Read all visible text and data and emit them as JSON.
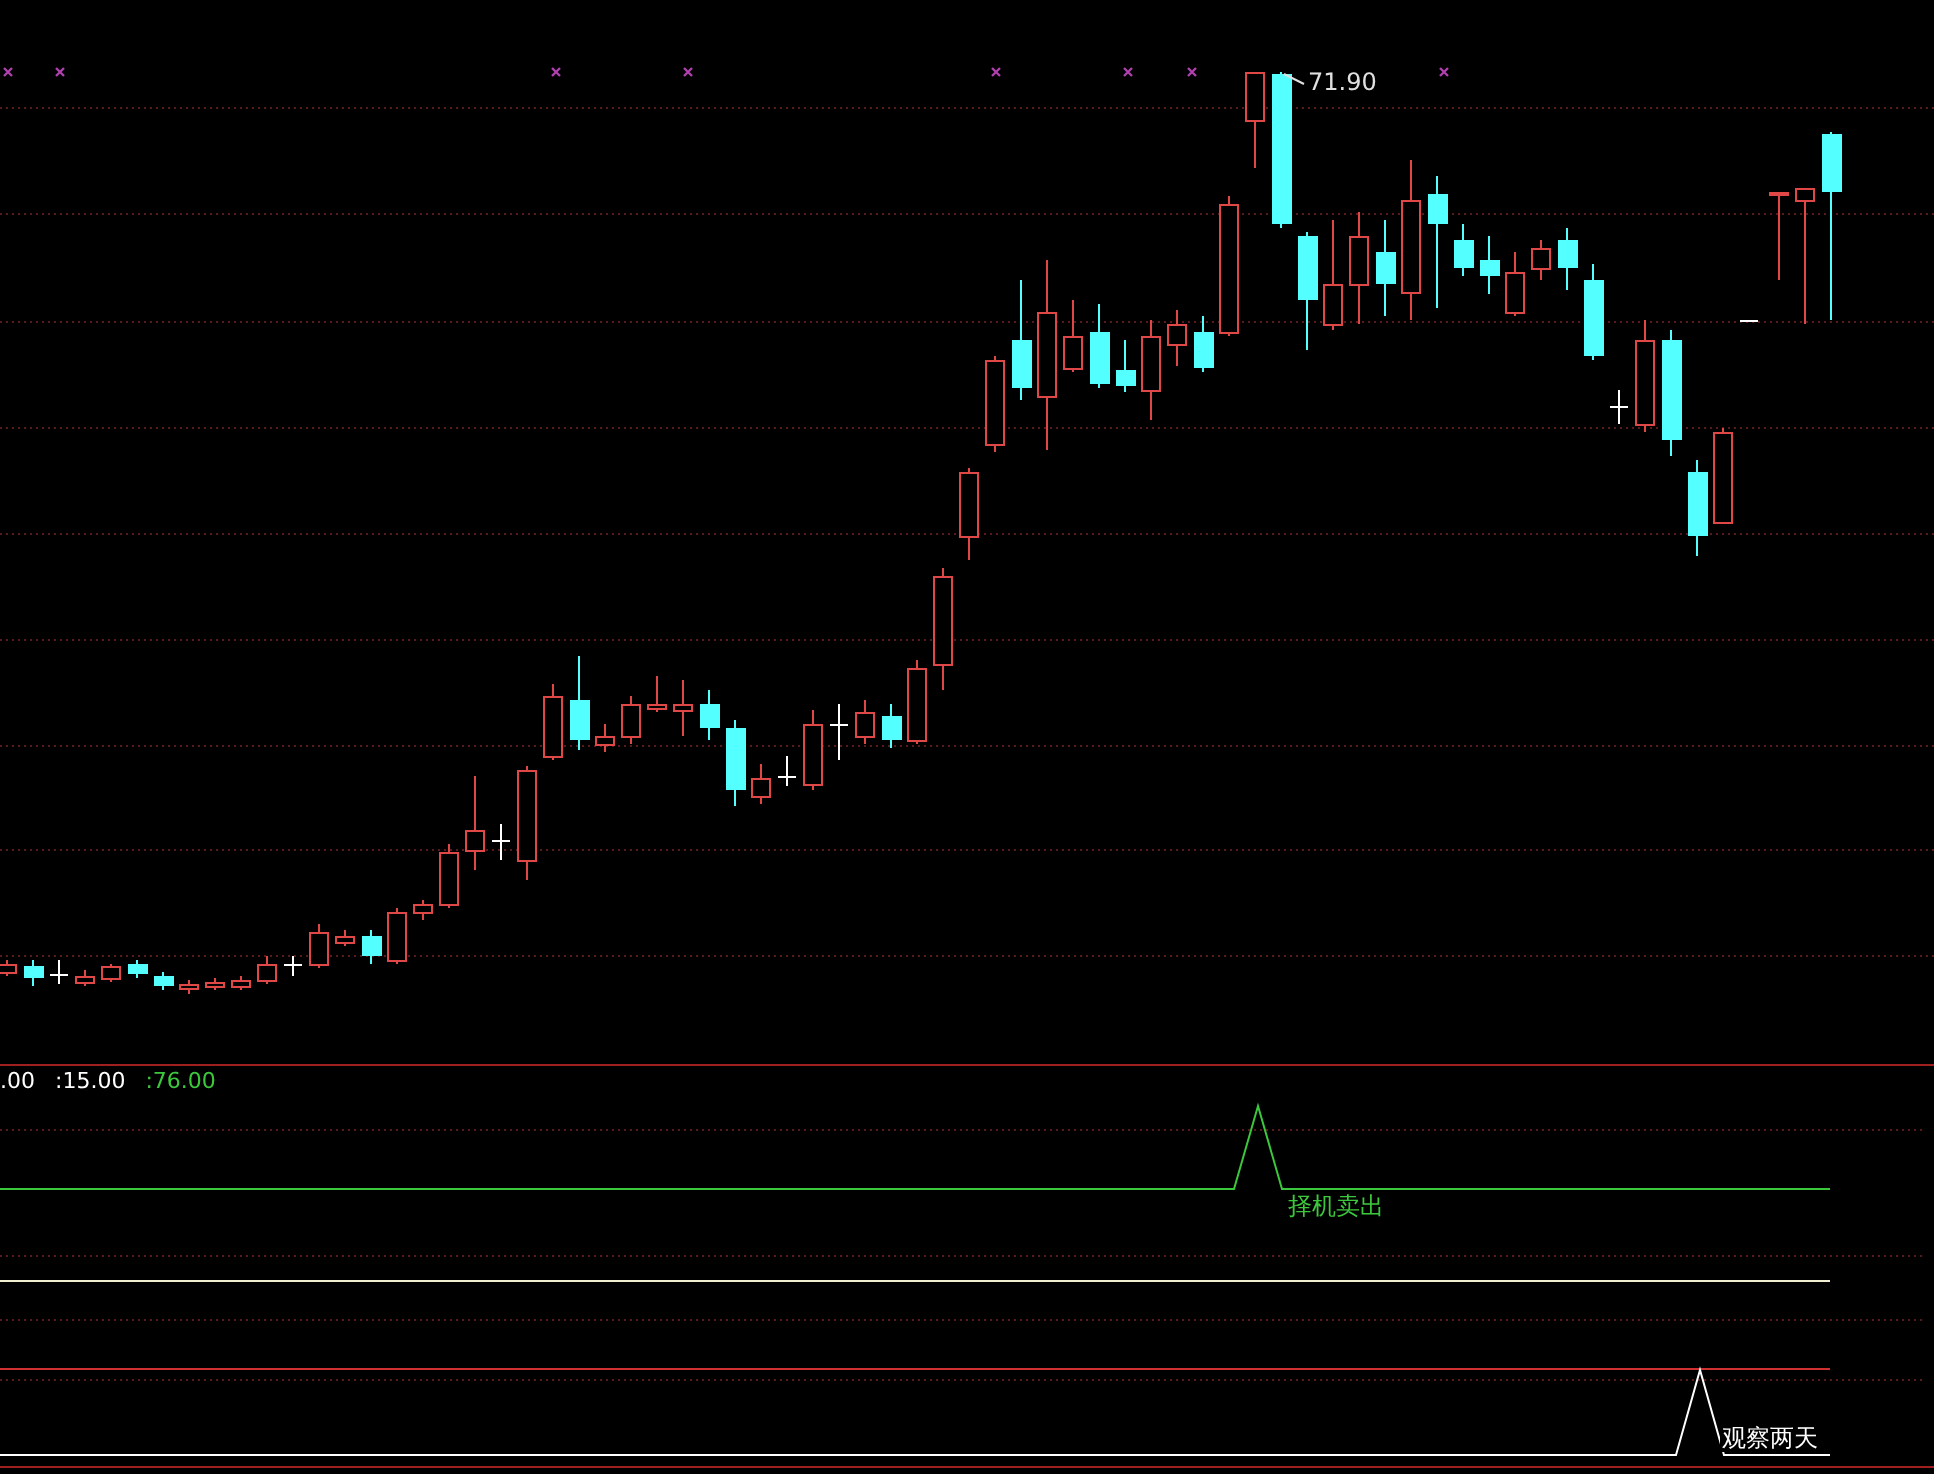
{
  "price_panel": {
    "high_label": "71.90"
  },
  "indicator_panel": {
    "values": [
      {
        "text": ".00",
        "color": "#ffffff"
      },
      {
        "text": ":15.00",
        "color": "#ffffff"
      },
      {
        "text": ":76.00",
        "color": "#3cc83c"
      }
    ],
    "signals": [
      {
        "kind": "sell",
        "label": "择机卖出",
        "color": "#3cc83c"
      },
      {
        "kind": "watch",
        "label": "观察两天",
        "color": "#ffffff"
      }
    ]
  }
}
